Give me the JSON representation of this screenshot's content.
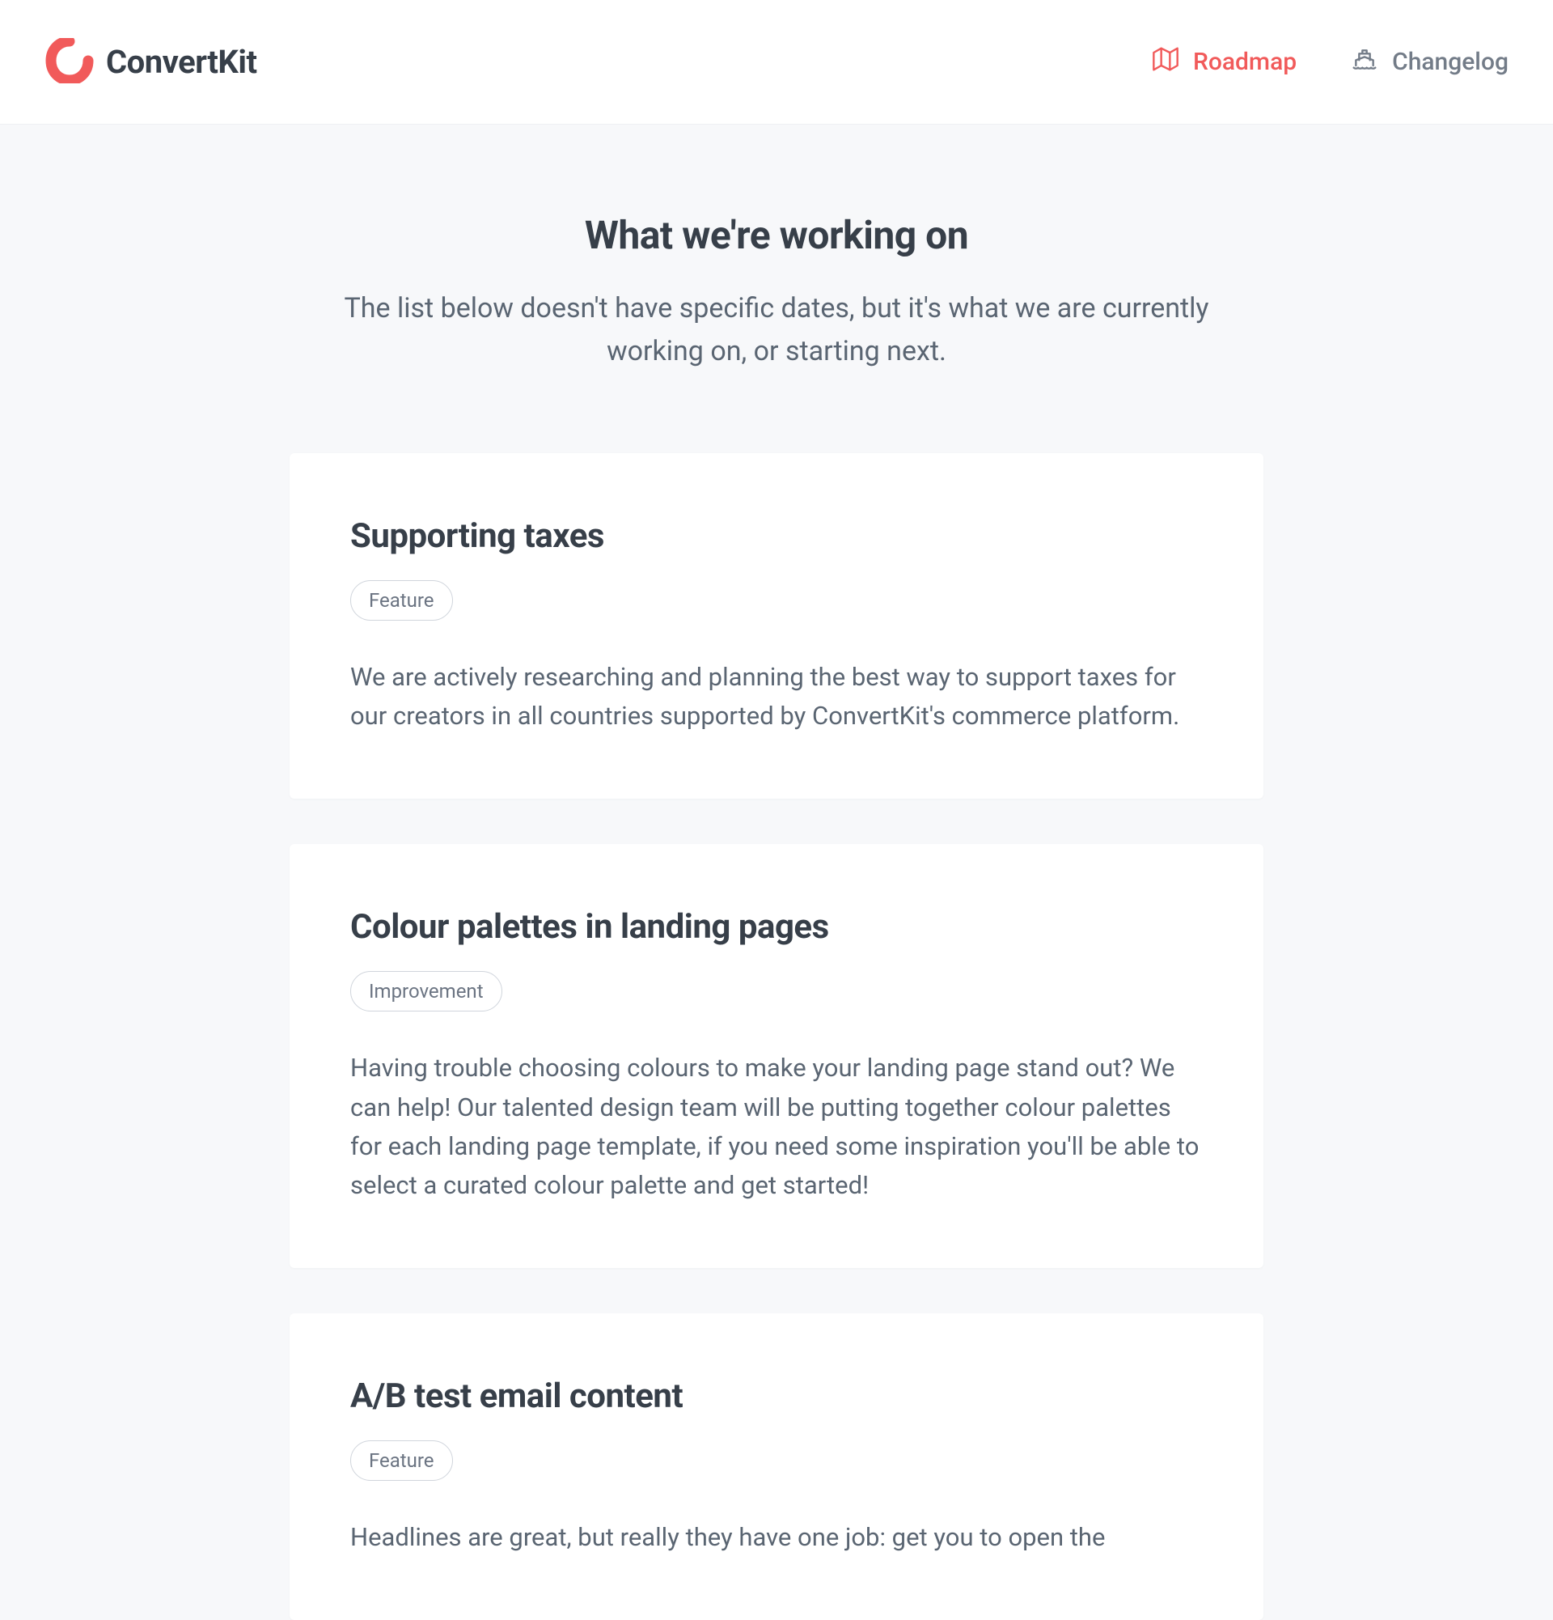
{
  "header": {
    "brand": "ConvertKit",
    "nav": {
      "roadmap": "Roadmap",
      "changelog": "Changelog"
    }
  },
  "page": {
    "title": "What we're working on",
    "subtitle": "The list below doesn't have specific dates, but it's what we are currently working on, or starting next."
  },
  "cards": [
    {
      "title": "Supporting taxes",
      "badge": "Feature",
      "description": "We are actively researching and planning the best way to support taxes for our creators in all countries supported by ConvertKit's commerce platform."
    },
    {
      "title": "Colour palettes in landing pages",
      "badge": "Improvement",
      "description": "Having trouble choosing colours to make your landing page stand out? We can help! Our talented design team will be putting together colour palettes for each landing page template, if you need some inspiration you'll be able to select a curated colour palette and get started!"
    },
    {
      "title": "A/B test email content",
      "badge": "Feature",
      "description": "Headlines are great, but really they have one job: get you to open the"
    }
  ]
}
